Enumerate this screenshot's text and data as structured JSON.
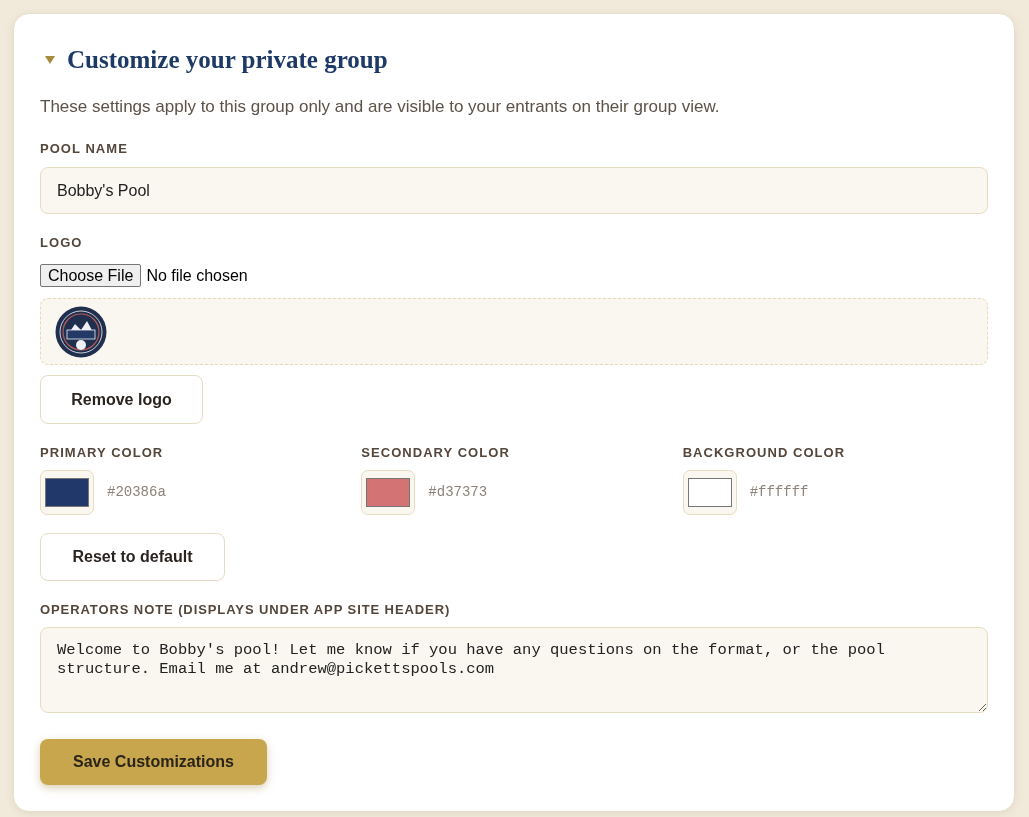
{
  "section": {
    "title": "Customize your private group",
    "expanded": true,
    "description": "These settings apply to this group only and are visible to your entrants on their group view."
  },
  "pool_name": {
    "label": "POOL NAME",
    "value": "Bobby's Pool"
  },
  "logo": {
    "label": "LOGO",
    "file_button": "Choose File",
    "file_status": "No file chosen",
    "remove_button": "Remove logo"
  },
  "colors": [
    {
      "label": "PRIMARY COLOR",
      "color": "#20386a",
      "value": "#20386a"
    },
    {
      "label": "SECONDARY COLOR",
      "color": "#d37373",
      "value": "#d37373"
    },
    {
      "label": "BACKGROUND COLOR",
      "color": "#ffffff",
      "value": "#ffffff"
    }
  ],
  "reset_button": "Reset to default",
  "operators_note": {
    "label": "OPERATORS NOTE (DISPLAYS UNDER APP SITE HEADER)",
    "value": "Welcome to Bobby's pool! Let me know if you have any questions on the format, or the pool structure. Email me at andrew@pickettspools.com"
  },
  "save_button": "Save Customizations"
}
